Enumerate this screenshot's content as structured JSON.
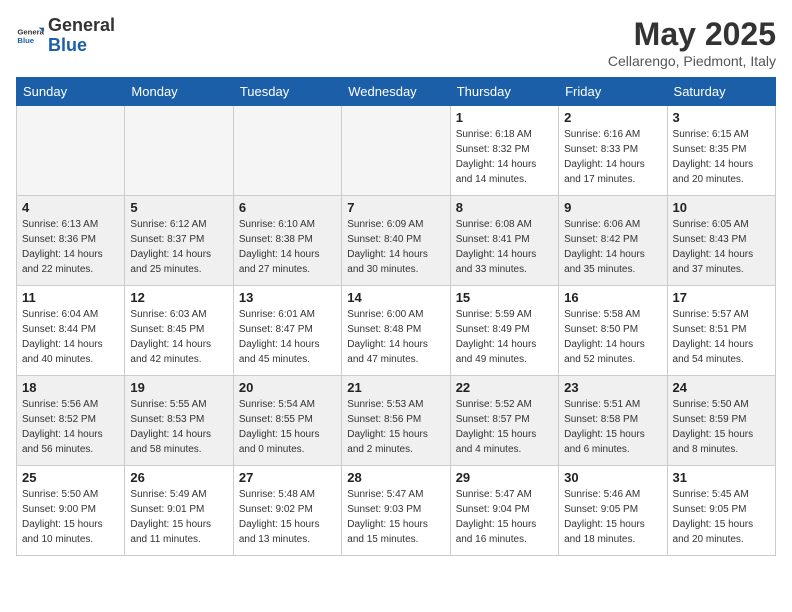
{
  "header": {
    "logo_general": "General",
    "logo_blue": "Blue",
    "month": "May 2025",
    "location": "Cellarengo, Piedmont, Italy"
  },
  "days_of_week": [
    "Sunday",
    "Monday",
    "Tuesday",
    "Wednesday",
    "Thursday",
    "Friday",
    "Saturday"
  ],
  "weeks": [
    [
      {
        "day": "",
        "info": ""
      },
      {
        "day": "",
        "info": ""
      },
      {
        "day": "",
        "info": ""
      },
      {
        "day": "",
        "info": ""
      },
      {
        "day": "1",
        "info": "Sunrise: 6:18 AM\nSunset: 8:32 PM\nDaylight: 14 hours\nand 14 minutes."
      },
      {
        "day": "2",
        "info": "Sunrise: 6:16 AM\nSunset: 8:33 PM\nDaylight: 14 hours\nand 17 minutes."
      },
      {
        "day": "3",
        "info": "Sunrise: 6:15 AM\nSunset: 8:35 PM\nDaylight: 14 hours\nand 20 minutes."
      }
    ],
    [
      {
        "day": "4",
        "info": "Sunrise: 6:13 AM\nSunset: 8:36 PM\nDaylight: 14 hours\nand 22 minutes."
      },
      {
        "day": "5",
        "info": "Sunrise: 6:12 AM\nSunset: 8:37 PM\nDaylight: 14 hours\nand 25 minutes."
      },
      {
        "day": "6",
        "info": "Sunrise: 6:10 AM\nSunset: 8:38 PM\nDaylight: 14 hours\nand 27 minutes."
      },
      {
        "day": "7",
        "info": "Sunrise: 6:09 AM\nSunset: 8:40 PM\nDaylight: 14 hours\nand 30 minutes."
      },
      {
        "day": "8",
        "info": "Sunrise: 6:08 AM\nSunset: 8:41 PM\nDaylight: 14 hours\nand 33 minutes."
      },
      {
        "day": "9",
        "info": "Sunrise: 6:06 AM\nSunset: 8:42 PM\nDaylight: 14 hours\nand 35 minutes."
      },
      {
        "day": "10",
        "info": "Sunrise: 6:05 AM\nSunset: 8:43 PM\nDaylight: 14 hours\nand 37 minutes."
      }
    ],
    [
      {
        "day": "11",
        "info": "Sunrise: 6:04 AM\nSunset: 8:44 PM\nDaylight: 14 hours\nand 40 minutes."
      },
      {
        "day": "12",
        "info": "Sunrise: 6:03 AM\nSunset: 8:45 PM\nDaylight: 14 hours\nand 42 minutes."
      },
      {
        "day": "13",
        "info": "Sunrise: 6:01 AM\nSunset: 8:47 PM\nDaylight: 14 hours\nand 45 minutes."
      },
      {
        "day": "14",
        "info": "Sunrise: 6:00 AM\nSunset: 8:48 PM\nDaylight: 14 hours\nand 47 minutes."
      },
      {
        "day": "15",
        "info": "Sunrise: 5:59 AM\nSunset: 8:49 PM\nDaylight: 14 hours\nand 49 minutes."
      },
      {
        "day": "16",
        "info": "Sunrise: 5:58 AM\nSunset: 8:50 PM\nDaylight: 14 hours\nand 52 minutes."
      },
      {
        "day": "17",
        "info": "Sunrise: 5:57 AM\nSunset: 8:51 PM\nDaylight: 14 hours\nand 54 minutes."
      }
    ],
    [
      {
        "day": "18",
        "info": "Sunrise: 5:56 AM\nSunset: 8:52 PM\nDaylight: 14 hours\nand 56 minutes."
      },
      {
        "day": "19",
        "info": "Sunrise: 5:55 AM\nSunset: 8:53 PM\nDaylight: 14 hours\nand 58 minutes."
      },
      {
        "day": "20",
        "info": "Sunrise: 5:54 AM\nSunset: 8:55 PM\nDaylight: 15 hours\nand 0 minutes."
      },
      {
        "day": "21",
        "info": "Sunrise: 5:53 AM\nSunset: 8:56 PM\nDaylight: 15 hours\nand 2 minutes."
      },
      {
        "day": "22",
        "info": "Sunrise: 5:52 AM\nSunset: 8:57 PM\nDaylight: 15 hours\nand 4 minutes."
      },
      {
        "day": "23",
        "info": "Sunrise: 5:51 AM\nSunset: 8:58 PM\nDaylight: 15 hours\nand 6 minutes."
      },
      {
        "day": "24",
        "info": "Sunrise: 5:50 AM\nSunset: 8:59 PM\nDaylight: 15 hours\nand 8 minutes."
      }
    ],
    [
      {
        "day": "25",
        "info": "Sunrise: 5:50 AM\nSunset: 9:00 PM\nDaylight: 15 hours\nand 10 minutes."
      },
      {
        "day": "26",
        "info": "Sunrise: 5:49 AM\nSunset: 9:01 PM\nDaylight: 15 hours\nand 11 minutes."
      },
      {
        "day": "27",
        "info": "Sunrise: 5:48 AM\nSunset: 9:02 PM\nDaylight: 15 hours\nand 13 minutes."
      },
      {
        "day": "28",
        "info": "Sunrise: 5:47 AM\nSunset: 9:03 PM\nDaylight: 15 hours\nand 15 minutes."
      },
      {
        "day": "29",
        "info": "Sunrise: 5:47 AM\nSunset: 9:04 PM\nDaylight: 15 hours\nand 16 minutes."
      },
      {
        "day": "30",
        "info": "Sunrise: 5:46 AM\nSunset: 9:05 PM\nDaylight: 15 hours\nand 18 minutes."
      },
      {
        "day": "31",
        "info": "Sunrise: 5:45 AM\nSunset: 9:05 PM\nDaylight: 15 hours\nand 20 minutes."
      }
    ]
  ]
}
